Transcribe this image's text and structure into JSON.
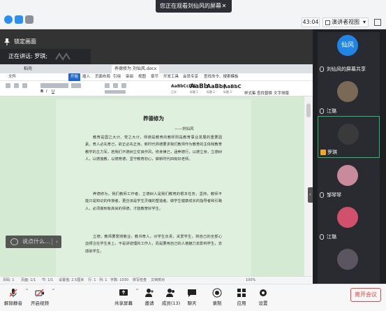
{
  "topbar": {
    "share_banner": "您正在观看刘仙风的屏幕",
    "close_symbol": "✕",
    "timer": "43:04",
    "view_button": "演讲者视图"
  },
  "share": {
    "pin_label": "锁定画面",
    "speaker_label": "正在讲话: 罗琪;"
  },
  "wps": {
    "tabs": [
      "稻壳",
      "养德修为 刘仙风.docx"
    ],
    "menu": [
      "文件",
      "开始",
      "插入",
      "页面布局",
      "引用",
      "审阅",
      "视图",
      "章节",
      "开发工具",
      "会员专享",
      "查找命令、搜索模板"
    ],
    "ribbon_styles": [
      {
        "big": "AaBbCcDd",
        "small": "正文"
      },
      {
        "big": "AaBb",
        "small": "标题 1"
      },
      {
        "big": "AaBb(",
        "small": "标题 2"
      },
      {
        "big": "AaBbC",
        "small": "标题 3"
      }
    ],
    "ribbon_labels": [
      "样式集",
      "查找替换",
      "文字排版"
    ],
    "doc": {
      "title": "养德修为",
      "author": "——刘仙风",
      "paragraphs": [
        "教育是国之大计、党之大计，师德是教育的教师则是教育事业发展的重要因素。育人必先育己，欲正必先正身。新时代师德要求我们教师作为教育的主体和教育教学的主力军，若我们不德树立优良作风，修身律己，涵养德行，以德立身，立德树人，以德施教，以德育德，坚守教育初心，做新时代四有好老师。",
        "养德修为，我们教师工作者，立德树人是我们教育的根本任务，坚持，教师不能只是知识的传授者，更应该是学生灵魂的塑造者。做学生健康成长的指导者和引路人，必须做到有高尚的师德，才能教育好学生。",
        "立德，教师要爱岗敬业，教书育人，对学生负责，关爱学生，将自己的全部心血倾注在学生身上，不是讲道理的工作人，而是要用自己的人格魅力去影响学生，去感染学生。"
      ]
    },
    "status": [
      "页码: 1",
      "页面: 1/1",
      "节: 1/1",
      "设置值: 2.5厘米",
      "行: 1",
      "列: 1",
      "字数: 1030",
      "拼写检查",
      "文档校对",
      "100%"
    ]
  },
  "chat": {
    "placeholder": "说点什么..."
  },
  "participants": [
    {
      "name": "刘仙风的屏幕共享",
      "avatar_text": "仙风",
      "type": "avatar"
    },
    {
      "name": "江璐",
      "type": "photo",
      "color": "#7a6a55"
    },
    {
      "name": "罗琪",
      "type": "photo",
      "color": "#3a3a3a",
      "active": true
    },
    {
      "name": "邹琴琴",
      "type": "photo",
      "color": "#c98a9b"
    },
    {
      "name": "江璐",
      "type": "photo",
      "color": "#d1506b"
    },
    {
      "name": "",
      "type": "photo",
      "color": "#5a5560"
    }
  ],
  "toolbar": {
    "items": [
      "解除静音",
      "开启视频",
      "共享屏幕",
      "邀请",
      "成员(13)",
      "聊天",
      "录制",
      "应用",
      "设置"
    ],
    "leave": "离开会议"
  },
  "colors": {
    "accent": "#1e66d0",
    "active_border": "#1fc16b",
    "leave": "#e64545",
    "doc_bg": "#d4ead2"
  }
}
